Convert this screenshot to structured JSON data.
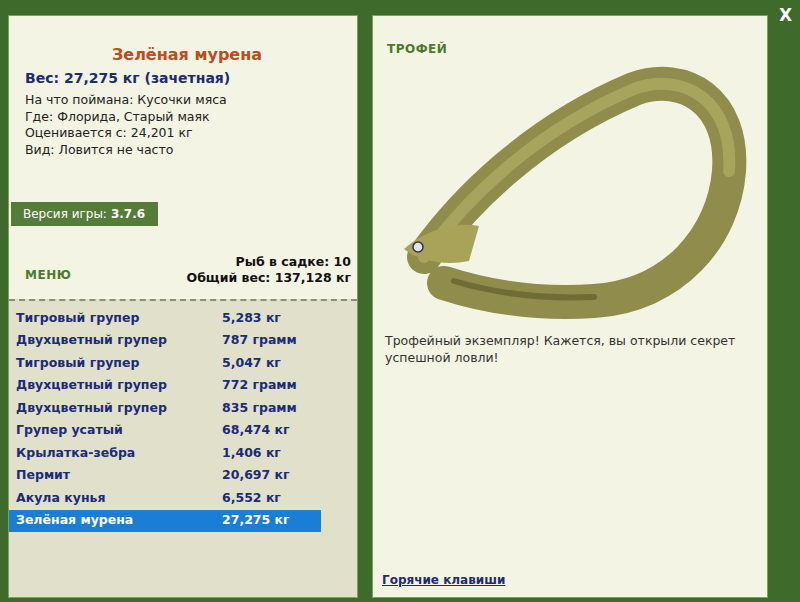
{
  "close": "X",
  "fish": {
    "title": "Зелёная мурена",
    "weight": "Вес: 27,275 кг (зачетная)",
    "details": [
      "На что поймана: Кусочки мяса",
      "Где: Флорида, Старый маяк",
      "Оценивается с: 24,201 кг",
      "Вид: Ловится не часто"
    ]
  },
  "version": {
    "label": "Версия игры:",
    "value": "3.7.6"
  },
  "menu": {
    "label": "МЕНЮ"
  },
  "keepnet": {
    "count": "Рыб в садке: 10",
    "total": "Общий вес: 137,128 кг"
  },
  "catch": [
    {
      "name": "Тигровый групер",
      "weight": "5,283 кг",
      "selected": false
    },
    {
      "name": "Двухцветный групер",
      "weight": "787 грамм",
      "selected": false
    },
    {
      "name": "Тигровый групер",
      "weight": "5,047 кг",
      "selected": false
    },
    {
      "name": "Двухцветный групер",
      "weight": "772 грамм",
      "selected": false
    },
    {
      "name": "Двухцветный групер",
      "weight": "835 грамм",
      "selected": false
    },
    {
      "name": "Групер усатый",
      "weight": "68,474 кг",
      "selected": false
    },
    {
      "name": "Крылатка-зебра",
      "weight": "1,406 кг",
      "selected": false
    },
    {
      "name": "Пермит",
      "weight": "20,697 кг",
      "selected": false
    },
    {
      "name": "Акула кунья",
      "weight": "6,552 кг",
      "selected": false
    },
    {
      "name": "Зелёная мурена",
      "weight": "27,275 кг",
      "selected": true
    }
  ],
  "trophy": {
    "label": "ТРОФЕЙ",
    "message": "Трофейный экземпляр! Кажется, вы открыли секрет успешной ловли!"
  },
  "hotkeys": "Горячие клавиши"
}
